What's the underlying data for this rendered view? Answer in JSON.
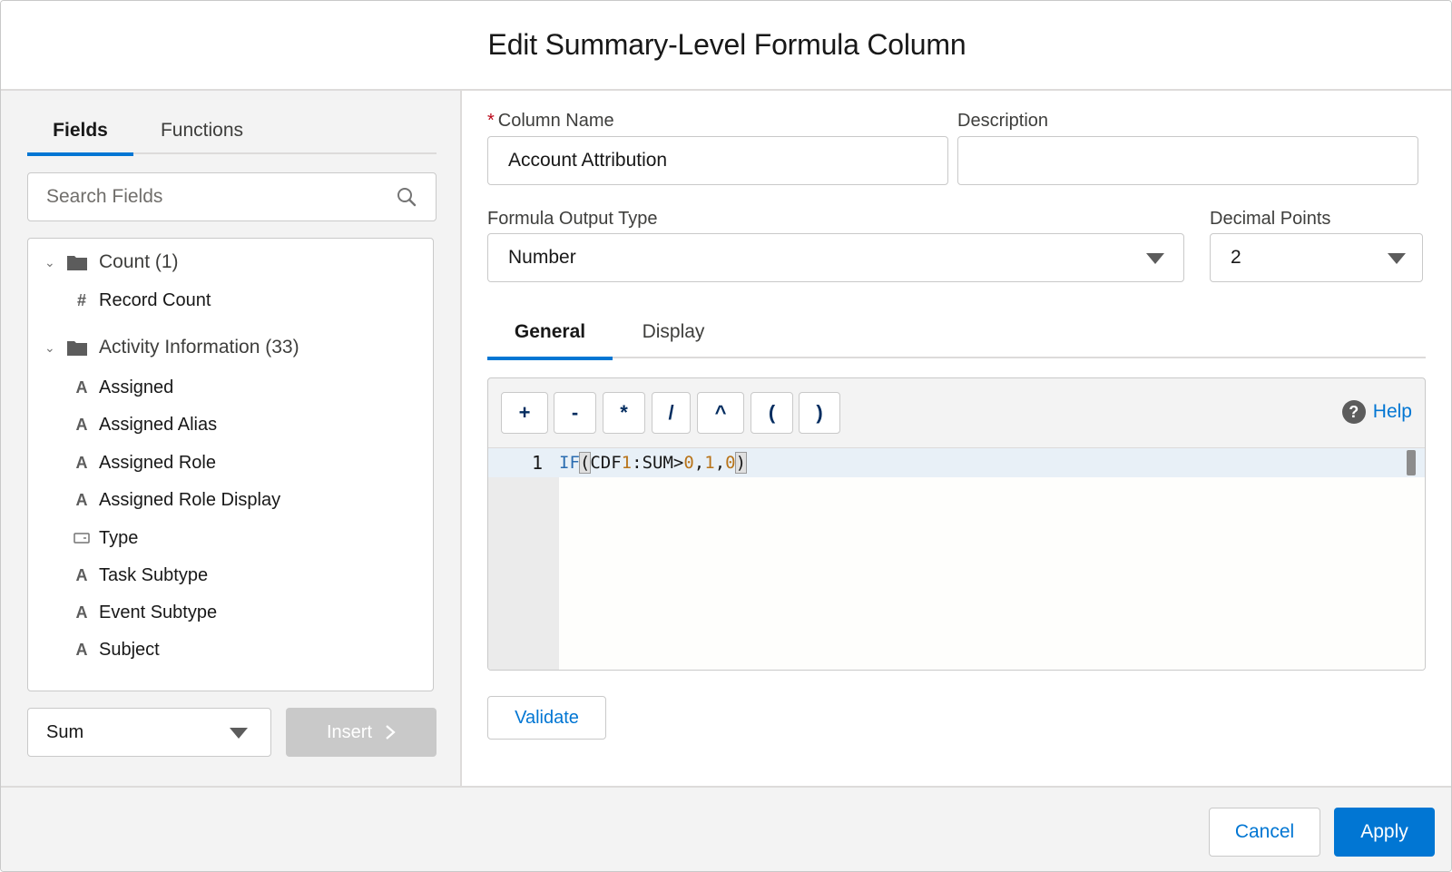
{
  "dialog": {
    "title": "Edit Summary-Level Formula Column"
  },
  "left": {
    "tabs": [
      {
        "label": "Fields",
        "active": true
      },
      {
        "label": "Functions",
        "active": false
      }
    ],
    "search": {
      "placeholder": "Search Fields",
      "value": ""
    },
    "groups": [
      {
        "label": "Count (1)",
        "expanded": true,
        "fields": [
          {
            "icon": "hash-icon",
            "label": "Record Count"
          }
        ]
      },
      {
        "label": "Activity Information (33)",
        "expanded": true,
        "fields": [
          {
            "icon": "text-icon",
            "label": "Assigned"
          },
          {
            "icon": "text-icon",
            "label": "Assigned Alias"
          },
          {
            "icon": "text-icon",
            "label": "Assigned Role"
          },
          {
            "icon": "text-icon",
            "label": "Assigned Role Display"
          },
          {
            "icon": "picklist-icon",
            "label": "Type"
          },
          {
            "icon": "text-icon",
            "label": "Task Subtype"
          },
          {
            "icon": "text-icon",
            "label": "Event Subtype"
          },
          {
            "icon": "text-icon",
            "label": "Subject"
          }
        ]
      }
    ],
    "summary_select": {
      "value": "Sum"
    },
    "insert_label": "Insert"
  },
  "right": {
    "column_name": {
      "label": "Column Name",
      "required": true,
      "value": "Account Attribution"
    },
    "description": {
      "label": "Description",
      "value": ""
    },
    "output_type": {
      "label": "Formula Output Type",
      "value": "Number"
    },
    "decimal_points": {
      "label": "Decimal Points",
      "value": "2"
    },
    "tabs": [
      {
        "label": "General",
        "active": true
      },
      {
        "label": "Display",
        "active": false
      }
    ],
    "operators": [
      "+",
      "-",
      "*",
      "/",
      "^",
      "(",
      ")"
    ],
    "help_label": "Help",
    "editor": {
      "line_number": "1",
      "formula": "IF(CDF1:SUM>0,1,0)",
      "tokens": {
        "fn": "IF",
        "p1": "(",
        "a": "CDF",
        "b": "1",
        "c": ":SUM>",
        "d": "0",
        "e": ",",
        "f": "1",
        "g": ",",
        "h": "0",
        "p2": ")"
      }
    },
    "validate_label": "Validate"
  },
  "footer": {
    "cancel_label": "Cancel",
    "apply_label": "Apply"
  },
  "colors": {
    "brand": "#0176d3",
    "required": "#ba0517",
    "code_keyword": "#2a6cb0",
    "code_number": "#b8741a"
  }
}
